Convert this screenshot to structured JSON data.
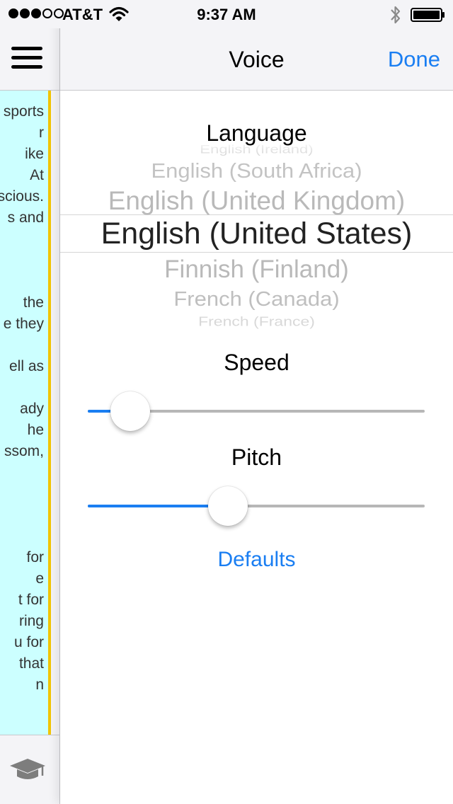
{
  "status_bar": {
    "carrier": "AT&T",
    "time": "9:37 AM",
    "signal_bars_filled": 3,
    "signal_bars_total": 5
  },
  "nav": {
    "title": "Voice",
    "done_label": "Done"
  },
  "language": {
    "label": "Language",
    "options": [
      "English (Ireland)",
      "English (South Africa)",
      "English (United Kingdom)",
      "English (United States)",
      "Finnish (Finland)",
      "French (Canada)",
      "French (France)"
    ],
    "selected": "English (United States)"
  },
  "speed": {
    "label": "Speed",
    "value_fraction": 0.11
  },
  "pitch": {
    "label": "Pitch",
    "value_fraction": 0.4
  },
  "defaults_label": "Defaults",
  "document_text_lines": [
    "sports",
    "r",
    "ike",
    "At",
    "scious.",
    "s and",
    "",
    "",
    "",
    "the",
    "e they",
    "",
    "ell as",
    "",
    "ady",
    "he",
    "ssom,",
    "",
    "",
    "",
    "",
    "for",
    "e",
    "t for",
    "ring",
    "u for",
    "that",
    "n"
  ],
  "colors": {
    "accent": "#1a7ef2",
    "document_highlight": "#ccffff",
    "document_margin_bar": "#f2c500"
  },
  "icons": {
    "menu": "hamburger-menu-icon",
    "wifi": "wifi-icon",
    "bluetooth": "bluetooth-icon",
    "battery": "battery-icon",
    "grad_cap": "graduation-cap-icon"
  }
}
